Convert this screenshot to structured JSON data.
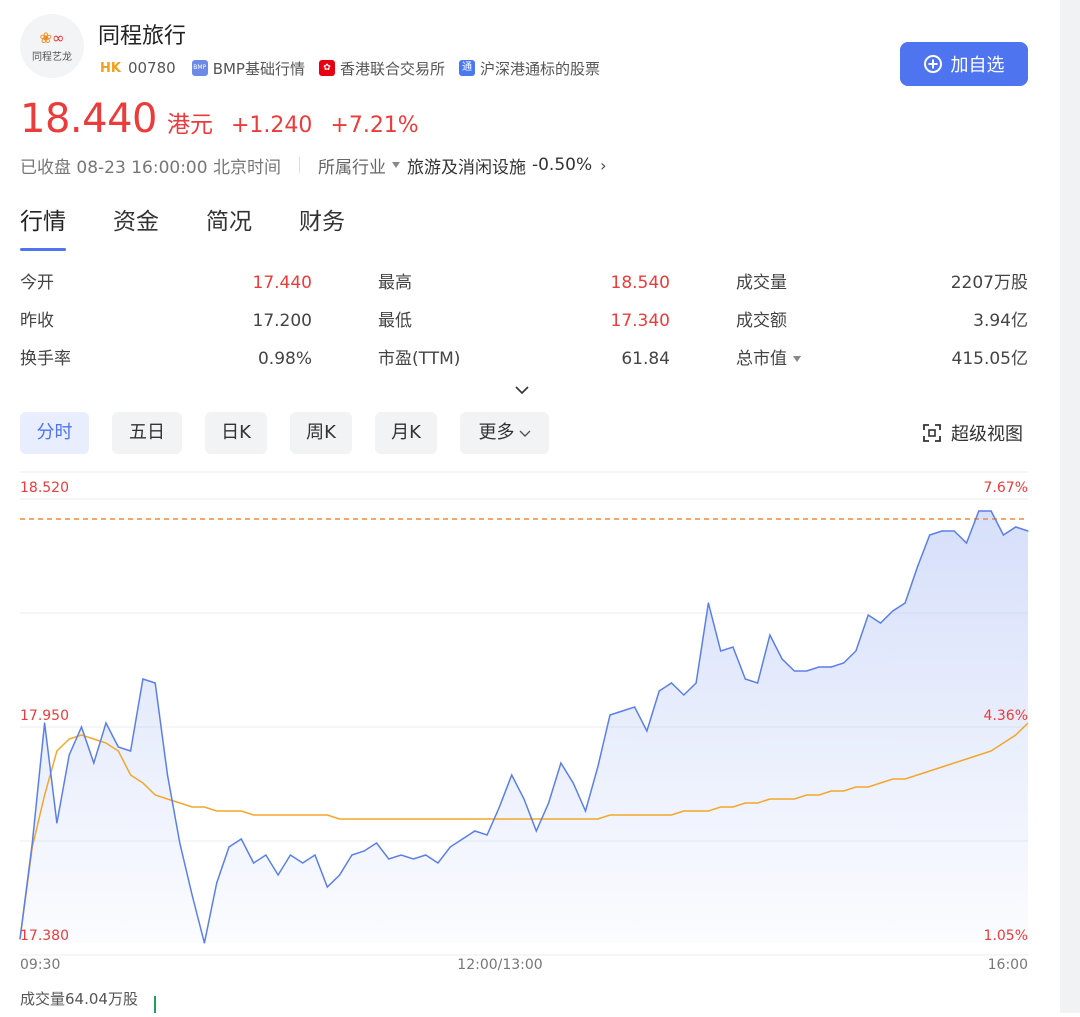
{
  "stock": {
    "name": "同程旅行",
    "market": "HK",
    "code": "00780",
    "tags": [
      {
        "label": "BMP基础行情",
        "badge": "BMP",
        "icon": "bmp-icon"
      },
      {
        "label": "香港联合交易所",
        "badge": "",
        "icon": "hkex-icon"
      },
      {
        "label": "沪深港通标的股票",
        "badge": "通",
        "icon": "connect-icon"
      }
    ],
    "logo_text": "同程艺龙"
  },
  "actions": {
    "add_watchlist": "加自选",
    "super_view": "超级视图"
  },
  "quote": {
    "price": "18.440",
    "currency": "港元",
    "change": "+1.240",
    "change_pct": "+7.21%",
    "status": "已收盘 08-23 16:00:00 北京时间",
    "industry_label": "所属行业",
    "industry_name": "旅游及消闲设施",
    "industry_change": "-0.50%"
  },
  "tabs": [
    "行情",
    "资金",
    "简况",
    "财务"
  ],
  "stats": [
    {
      "label": "今开",
      "value": "17.440",
      "red": true
    },
    {
      "label": "最高",
      "value": "18.540",
      "red": true
    },
    {
      "label": "成交量",
      "value": "2207万股",
      "red": false
    },
    {
      "label": "昨收",
      "value": "17.200",
      "red": false
    },
    {
      "label": "最低",
      "value": "17.340",
      "red": true
    },
    {
      "label": "成交额",
      "value": "3.94亿",
      "red": false
    },
    {
      "label": "换手率",
      "value": "0.98%",
      "red": false
    },
    {
      "label": "市盈(TTM)",
      "value": "61.84",
      "red": false
    },
    {
      "label": "总市值",
      "value": "415.05亿",
      "red": false
    }
  ],
  "periods": [
    "分时",
    "五日",
    "日K",
    "周K",
    "月K",
    "更多"
  ],
  "colors": {
    "up_red": "#ec3b3b",
    "accent_blue": "#4e74f0",
    "price_line": "#5b7fe8",
    "avg_line": "#f2a72a",
    "ref_line": "#f08a3c",
    "volume_green": "#22a05b"
  },
  "chart_data": {
    "type": "line",
    "ylim": [
      17.38,
      18.52
    ],
    "y_labels_left": [
      "18.520",
      "17.950",
      "17.380"
    ],
    "y_labels_right": [
      "7.67%",
      "4.36%",
      "1.05%"
    ],
    "x_labels": [
      "09:30",
      "12:00/13:00",
      "16:00"
    ],
    "reference_line": 18.44,
    "series": [
      {
        "values": [
          17.39,
          17.63,
          17.93,
          17.68,
          17.85,
          17.92,
          17.83,
          17.93,
          17.87,
          17.86,
          18.04,
          18.03,
          17.8,
          17.63,
          17.5,
          17.38,
          17.53,
          17.62,
          17.64,
          17.58,
          17.6,
          17.55,
          17.6,
          17.58,
          17.6,
          17.52,
          17.55,
          17.6,
          17.61,
          17.63,
          17.59,
          17.6,
          17.59,
          17.6,
          17.58,
          17.62,
          17.64,
          17.66,
          17.65,
          17.72,
          17.8,
          17.74,
          17.66,
          17.73,
          17.83,
          17.78,
          17.71,
          17.82,
          17.95,
          17.96,
          17.97,
          17.91,
          18.01,
          18.03,
          18.0,
          18.03,
          18.23,
          18.11,
          18.12,
          18.04,
          18.03,
          18.15,
          18.09,
          18.06,
          18.06,
          18.07,
          18.07,
          18.08,
          18.11,
          18.2,
          18.18,
          18.21,
          18.23,
          18.32,
          18.4,
          18.41,
          18.41,
          18.38,
          18.46,
          18.46,
          18.4,
          18.42,
          18.41
        ]
      },
      {
        "values": [
          17.39,
          17.62,
          17.75,
          17.86,
          17.89,
          17.9,
          17.89,
          17.88,
          17.86,
          17.8,
          17.78,
          17.75,
          17.74,
          17.73,
          17.72,
          17.72,
          17.71,
          17.71,
          17.71,
          17.7,
          17.7,
          17.7,
          17.7,
          17.7,
          17.7,
          17.7,
          17.69,
          17.69,
          17.69,
          17.69,
          17.69,
          17.69,
          17.69,
          17.69,
          17.69,
          17.69,
          17.69,
          17.69,
          17.69,
          17.69,
          17.69,
          17.69,
          17.69,
          17.69,
          17.69,
          17.69,
          17.69,
          17.69,
          17.7,
          17.7,
          17.7,
          17.7,
          17.7,
          17.7,
          17.71,
          17.71,
          17.71,
          17.72,
          17.72,
          17.73,
          17.73,
          17.74,
          17.74,
          17.74,
          17.75,
          17.75,
          17.76,
          17.76,
          17.77,
          17.77,
          17.78,
          17.79,
          17.79,
          17.8,
          17.81,
          17.82,
          17.83,
          17.84,
          17.85,
          17.86,
          17.88,
          17.9,
          17.93
        ]
      }
    ],
    "volume_label": "成交量64.04万股"
  }
}
